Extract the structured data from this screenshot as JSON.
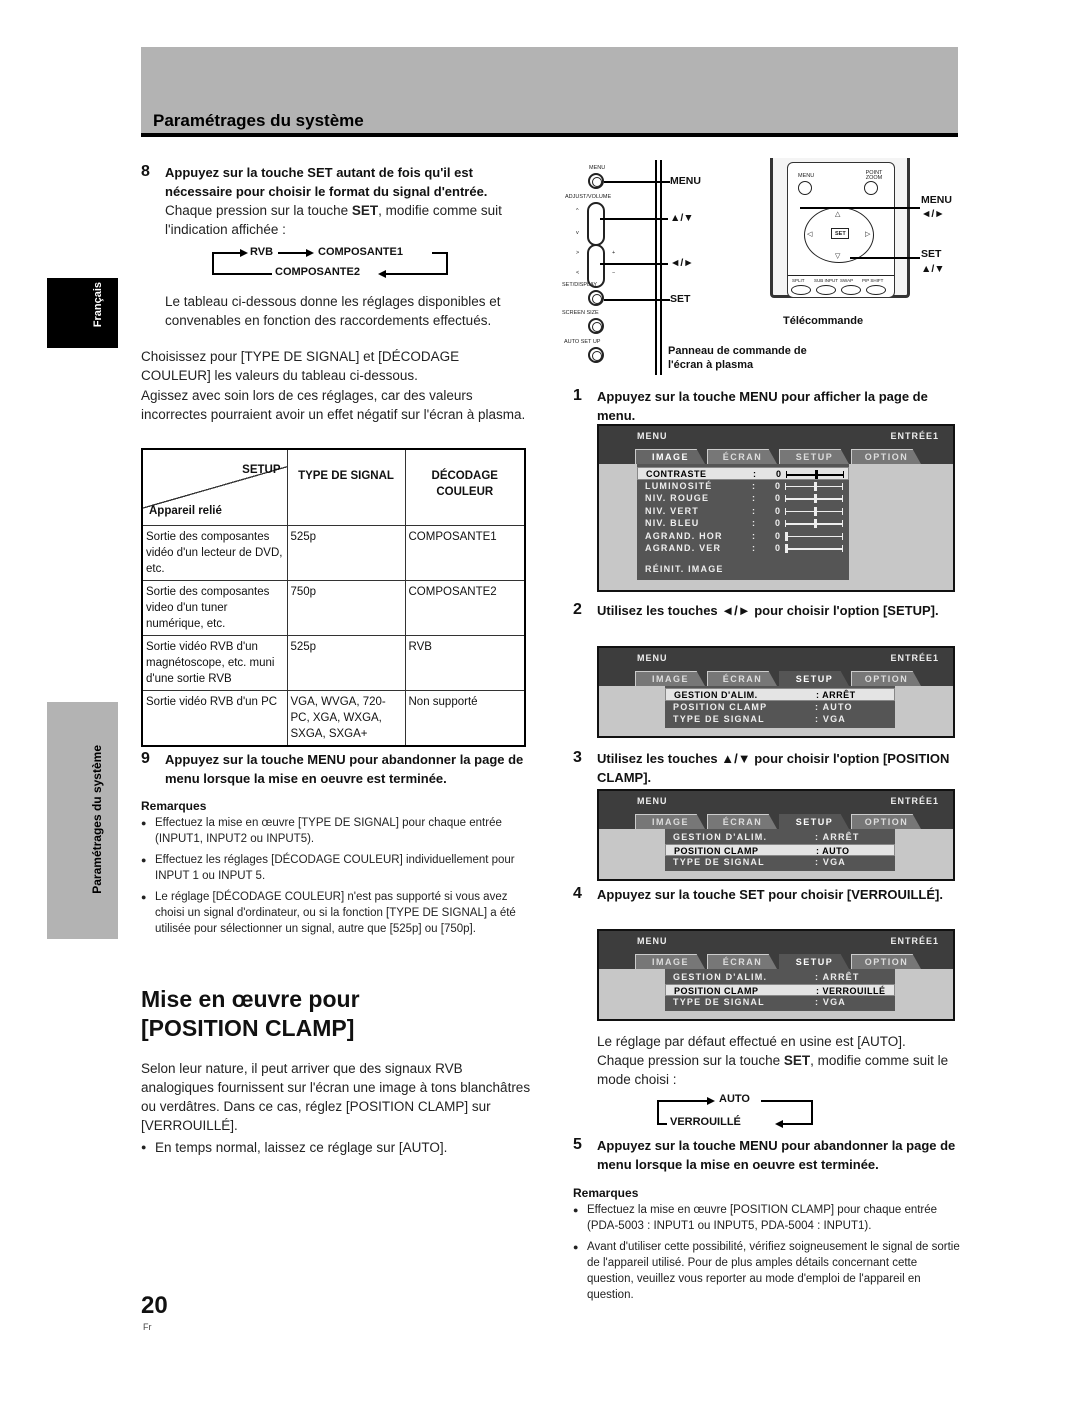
{
  "header": {
    "section_title": "Paramétrages du système"
  },
  "side_tabs": {
    "language": "Français",
    "section": "Paramétrages du système"
  },
  "left": {
    "step8": {
      "number": "8",
      "heading": "Appuyez sur la touche SET autant de fois qu'il est nécessaire pour choisir le format du signal d'entrée.",
      "text_pre": "Chaque pression sur la touche ",
      "text_bold": "SET",
      "text_post": ", modifie comme suit l'indication affichée :",
      "cycle": [
        "RVB",
        "COMPOSANTE1",
        "COMPOSANTE2"
      ],
      "text_after": "Le tableau ci-dessous donne les réglages disponibles et convenables en fonction des raccordements effectués."
    },
    "para1": "Choisissez pour [TYPE DE SIGNAL] et [DÉCODAGE COULEUR] les valeurs du tableau ci-dessous.",
    "para2": "Agissez avec soin lors de ces réglages, car des valeurs incorrectes pourraient avoir un effet négatif sur l'écran à plasma.",
    "table": {
      "header_setup": "SETUP",
      "header_device": "Appareil relié",
      "header_signal": "TYPE DE SIGNAL",
      "header_color": "DÉCODAGE COULEUR",
      "rows": [
        {
          "device": "Sortie des composantes vidéo d'un lecteur de DVD, etc.",
          "signal": "525p",
          "color": "COMPOSANTE1"
        },
        {
          "device": "Sortie des composantes video d'un tuner numérique, etc.",
          "signal": "750p",
          "color": "COMPOSANTE2"
        },
        {
          "device": "Sortie vidéo RVB d'un magnétoscope, etc. muni d'une sortie RVB",
          "signal": "525p",
          "color": "RVB"
        },
        {
          "device": "Sortie vidéo RVB d'un PC",
          "signal": "VGA, WVGA, 720-PC, XGA, WXGA, SXGA, SXGA+",
          "color": "Non supporté"
        }
      ]
    },
    "step9": {
      "number": "9",
      "heading": "Appuyez sur la touche MENU pour abandonner la page de menu lorsque la mise en oeuvre est terminée."
    },
    "remarks": {
      "title": "Remarques",
      "items": [
        "Effectuez la mise en œuvre [TYPE DE SIGNAL] pour chaque entrée (INPUT1, INPUT2 ou INPUT5).",
        "Effectuez les réglages [DÉCODAGE COULEUR] individuellement pour INPUT 1 ou INPUT 5.",
        "Le réglage [DÉCODAGE COULEUR] n'est pas supporté si vous avez choisi un signal d'ordinateur, ou si la fonction [TYPE DE SIGNAL] a été utilisée pour sélectionner un signal, autre que [525p] ou [750p]."
      ]
    },
    "section": {
      "title_line1": "Mise en œuvre pour",
      "title_line2": "[POSITION CLAMP]",
      "intro": "Selon leur nature, il peut arriver que des signaux RVB analogiques fournissent sur l'écran une image à tons blanchâtres ou verdâtres. Dans ce cas, réglez [POSITION CLAMP] sur [VERROUILLÉ].",
      "bullet": "En temps normal, laissez ce réglage sur [AUTO]."
    }
  },
  "diagram": {
    "panel_labels": [
      "MENU",
      "ADJUST/VOLUME",
      "SET/DISPLAY",
      "SCREEN SIZE",
      "AUTO SET UP"
    ],
    "panel_callouts": {
      "menu": "MENU",
      "updown": "▲/▼",
      "leftright": "◄/►",
      "set": "SET"
    },
    "panel_caption": "Panneau de commande de l'écran à plasma",
    "remote_buttons": [
      "MENU",
      "POINT ZOOM",
      "SET",
      "SPLIT",
      "SUB INPUT",
      "SWAP",
      "PIP SHIFT"
    ],
    "remote_callouts": {
      "menu": "MENU",
      "leftright": "◄/►",
      "set": "SET",
      "updown": "▲/▼"
    },
    "remote_caption": "Télécommande"
  },
  "right": {
    "step1": {
      "number": "1",
      "heading": "Appuyez sur la touche MENU pour afficher la page de menu."
    },
    "step2": {
      "number": "2",
      "heading": "Utilisez les touches ◄/► pour choisir l'option [SETUP]."
    },
    "step3": {
      "number": "3",
      "heading": "Utilisez les touches ▲/▼ pour choisir l'option [POSITION CLAMP]."
    },
    "step4": {
      "number": "4",
      "heading": "Appuyez sur la touche SET pour choisir [VERROUILLÉ]."
    },
    "default_text": "Le réglage par défaut effectué en usine est [AUTO].",
    "set_text_pre": "Chaque pression sur la touche ",
    "set_text_bold": "SET",
    "set_text_post": ", modifie comme suit le mode choisi :",
    "cycle": [
      "AUTO",
      "VERROUILLÉ"
    ],
    "step5": {
      "number": "5",
      "heading": "Appuyez sur la touche MENU pour abandonner la page de menu lorsque la mise en oeuvre est terminée."
    },
    "remarks": {
      "title": "Remarques",
      "items": [
        "Effectuez la mise en œuvre [POSITION CLAMP] pour chaque entrée (PDA-5003 : INPUT1 ou INPUT5, PDA-5004 : INPUT1).",
        "Avant d'utiliser cette possibilité, vérifiez soigneusement le signal de sortie de l'appareil utilisé. Pour de plus amples détails concernant cette question, veuillez vous reporter au mode d'emploi de l'appareil en question."
      ]
    }
  },
  "osd": {
    "menu_label": "MENU",
    "input_label": "ENTRÉE1",
    "tabs": [
      "IMAGE",
      "ÉCRAN",
      "SETUP",
      "OPTION"
    ],
    "image_menu": {
      "items": [
        {
          "label": "CONTRASTE",
          "value": "0",
          "level": 0.5
        },
        {
          "label": "LUMINOSITÉ",
          "value": "0",
          "level": 0.5
        },
        {
          "label": "NIV. ROUGE",
          "value": "0",
          "level": 0.5
        },
        {
          "label": "NIV. VERT",
          "value": "0",
          "level": 0.5
        },
        {
          "label": "NIV. BLEU",
          "value": "0",
          "level": 0.5
        },
        {
          "label": "AGRAND. HOR",
          "value": "0",
          "level": 0.0
        },
        {
          "label": "AGRAND. VER",
          "value": "0",
          "level": 0.0
        }
      ],
      "reset": "RÉINIT. IMAGE"
    },
    "setup_menus": [
      {
        "items": [
          {
            "label": "GESTION D'ALIM.",
            "value": ": ARRÊT"
          },
          {
            "label": "POSITION CLAMP",
            "value": ": AUTO"
          },
          {
            "label": "TYPE DE SIGNAL",
            "value": ": VGA"
          }
        ]
      },
      {
        "items": [
          {
            "label": "GESTION D'ALIM.",
            "value": ": ARRÊT"
          },
          {
            "label": "POSITION CLAMP",
            "value": ": AUTO"
          },
          {
            "label": "TYPE DE SIGNAL",
            "value": ": VGA"
          }
        ]
      },
      {
        "items": [
          {
            "label": "GESTION D'ALIM.",
            "value": ": ARRÊT"
          },
          {
            "label": "POSITION CLAMP",
            "value": ": VERROUILLÉ"
          },
          {
            "label": "TYPE DE SIGNAL",
            "value": ": VGA"
          }
        ]
      }
    ]
  },
  "footer": {
    "page_number": "20",
    "language_code": "Fr"
  }
}
